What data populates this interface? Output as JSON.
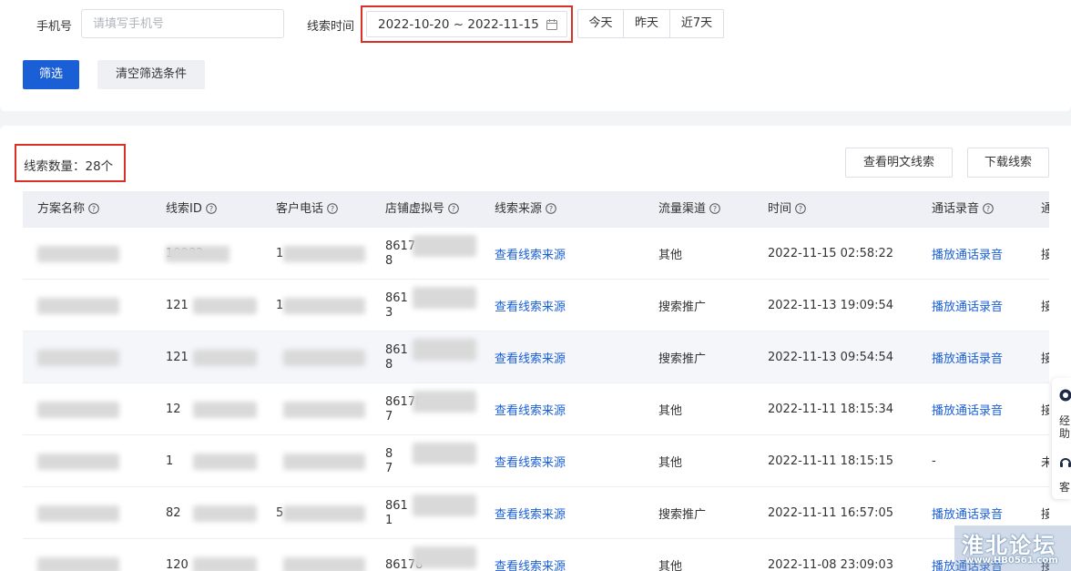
{
  "filter": {
    "phone_label": "手机号",
    "phone_placeholder": "请填写手机号",
    "time_label": "线索时间",
    "date_range": "2022-10-20 ~ 2022-11-15",
    "quick_ranges": [
      "今天",
      "昨天",
      "近7天"
    ],
    "filter_button": "筛选",
    "clear_button": "清空筛选条件"
  },
  "list": {
    "count_label": "线索数量：28个",
    "view_plain_button": "查看明文线索",
    "download_button": "下载线索"
  },
  "table": {
    "columns": [
      "方案名称",
      "线索ID",
      "客户电话",
      "店铺虚拟号",
      "线索来源",
      "流量渠道",
      "时间",
      "通话录音",
      "通"
    ],
    "rows": [
      {
        "id": "10982",
        "phone": "1",
        "vnum": "8617\n8",
        "source": "查看线索来源",
        "channel": "其他",
        "time": "2022-11-15 02:58:22",
        "recording": "播放通话录音",
        "last": "接"
      },
      {
        "id": "121",
        "phone": "1",
        "vnum": "861\n3",
        "source": "查看线索来源",
        "channel": "搜索推广",
        "time": "2022-11-13 19:09:54",
        "recording": "播放通话录音",
        "last": "接"
      },
      {
        "id": "121",
        "phone": "",
        "vnum": "861\n8",
        "source": "查看线索来源",
        "channel": "搜索推广",
        "time": "2022-11-13 09:54:54",
        "recording": "播放通话录音",
        "last": "接"
      },
      {
        "id": "12",
        "phone": "",
        "vnum": "86178\n7",
        "source": "查看线索来源",
        "channel": "其他",
        "time": "2022-11-11 18:15:34",
        "recording": "播放通话录音",
        "last": "接"
      },
      {
        "id": "1",
        "phone": "",
        "vnum": "8\n7",
        "source": "查看线索来源",
        "channel": "其他",
        "time": "2022-11-11 18:15:15",
        "recording": "-",
        "last": "未"
      },
      {
        "id": "82",
        "phone": "5",
        "vnum": "861\n1",
        "source": "查看线索来源",
        "channel": "搜索推广",
        "time": "2022-11-11 16:57:05",
        "recording": "播放通话录音",
        "last": "接"
      },
      {
        "id": "120",
        "phone": "",
        "vnum": "86178",
        "source": "查看线索来源",
        "channel": "其他",
        "time": "2022-11-08 23:09:03",
        "recording": "播放通话录音",
        "last": "接"
      }
    ]
  },
  "side_widget": {
    "label_1": "经\n助",
    "label_2": "客"
  },
  "watermark": {
    "title": "淮北论坛",
    "url": "www.HB0561.com"
  },
  "colors": {
    "primary": "#1a5fd6",
    "highlight_border": "#d93025",
    "header_bg": "#eef0f6"
  }
}
